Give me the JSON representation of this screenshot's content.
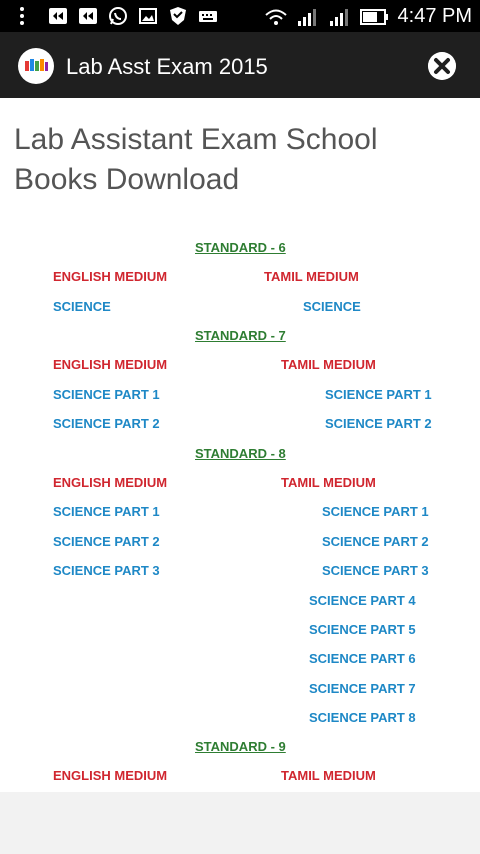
{
  "statusbar": {
    "time": "4:47 PM",
    "icons": [
      "overflow-icon",
      "notification-icon",
      "notification-icon",
      "whatsapp-icon",
      "image-icon",
      "shield-icon",
      "keyboard-icon",
      "wifi-icon",
      "signal-icon",
      "signal-icon",
      "battery-icon"
    ]
  },
  "app": {
    "title": "Lab Asst Exam 2015",
    "close_icon": "close-icon"
  },
  "page": {
    "title": "Lab Assistant Exam School Books Download"
  },
  "sections": [
    {
      "standard": "STANDARD - 6",
      "english": {
        "header": "ENGLISH MEDIUM",
        "items": [
          "SCIENCE"
        ]
      },
      "tamil": {
        "header": "TAMIL MEDIUM",
        "items": [
          "SCIENCE"
        ]
      }
    },
    {
      "standard": "STANDARD - 7",
      "english": {
        "header": "ENGLISH MEDIUM",
        "items": [
          "SCIENCE PART 1",
          "SCIENCE PART 2"
        ]
      },
      "tamil": {
        "header": "TAMIL MEDIUM",
        "items": [
          "SCIENCE PART 1",
          "SCIENCE PART 2"
        ]
      }
    },
    {
      "standard": "STANDARD - 8",
      "english": {
        "header": "ENGLISH MEDIUM",
        "items": [
          "SCIENCE PART 1",
          "SCIENCE PART 2",
          "SCIENCE PART 3"
        ]
      },
      "tamil": {
        "header": "TAMIL MEDIUM",
        "items": [
          "SCIENCE PART 1",
          "SCIENCE PART 2",
          "SCIENCE PART 3",
          "SCIENCE PART 4",
          "SCIENCE PART 5",
          "SCIENCE PART 6",
          "SCIENCE PART 7",
          "SCIENCE PART 8"
        ]
      }
    },
    {
      "standard": "STANDARD - 9",
      "english": {
        "header": "ENGLISH MEDIUM",
        "items": []
      },
      "tamil": {
        "header": "TAMIL MEDIUM",
        "items": []
      }
    }
  ],
  "colors": {
    "standard": "#2e7d32",
    "medium_header": "#d0262f",
    "link": "#1e88c6"
  }
}
